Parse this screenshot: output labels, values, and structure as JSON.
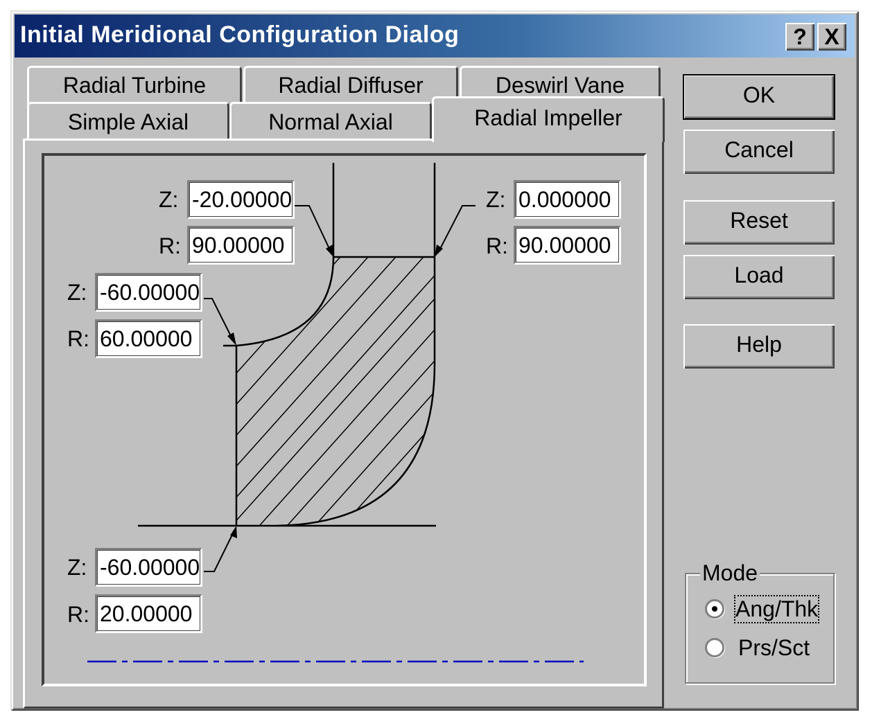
{
  "window": {
    "title": "Initial Meridional Configuration Dialog",
    "help_button": "?",
    "close_button": "X"
  },
  "tabs": {
    "row_back": [
      "Radial Turbine",
      "Radial Diffuser",
      "Deswirl Vane"
    ],
    "row_front": [
      "Simple Axial",
      "Normal Axial",
      "Radial Impeller"
    ],
    "active": "Radial Impeller"
  },
  "points": {
    "shroud_inlet": {
      "z_label": "Z:",
      "z_value": "-20.00000",
      "r_label": "R:",
      "r_value": "90.00000"
    },
    "shroud_outlet": {
      "z_label": "Z:",
      "z_value": "0.000000",
      "r_label": "R:",
      "r_value": "90.00000"
    },
    "hub_mid": {
      "z_label": "Z:",
      "z_value": "-60.00000",
      "r_label": "R:",
      "r_value": "60.00000"
    },
    "hub_inlet": {
      "z_label": "Z:",
      "z_value": "-60.00000",
      "r_label": "R:",
      "r_value": "20.00000"
    }
  },
  "buttons": {
    "ok": "OK",
    "cancel": "Cancel",
    "reset": "Reset",
    "load": "Load",
    "help": "Help"
  },
  "mode": {
    "label": "Mode",
    "options": [
      "Ang/Thk",
      "Prs/Sct"
    ],
    "selected": "Ang/Thk"
  },
  "colors": {
    "title_bar": "#0a246a",
    "face": "#c0c0c0",
    "axis_line": "#0000c0"
  }
}
